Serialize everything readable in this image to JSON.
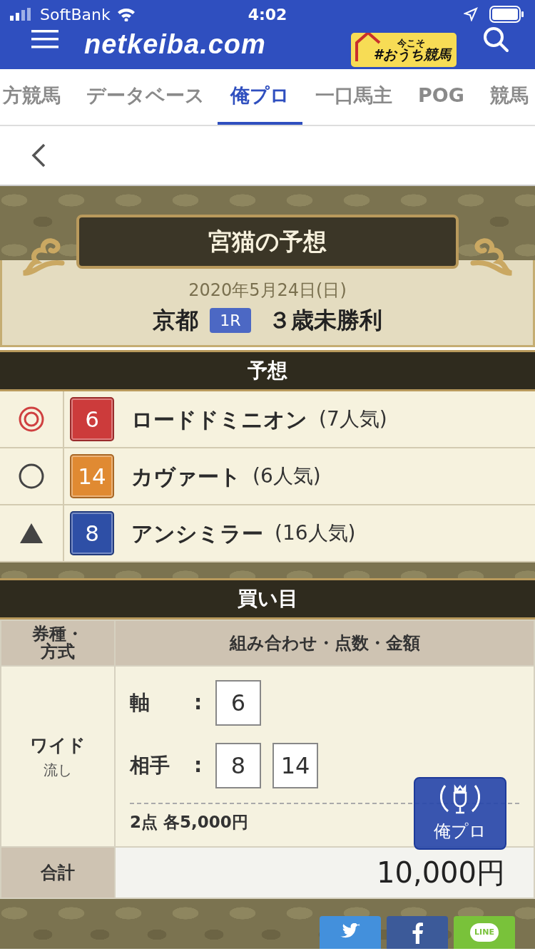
{
  "status_bar": {
    "carrier": "SoftBank",
    "time": "4:02"
  },
  "header": {
    "logo": "netkeiba.com",
    "banner_top": "今こそ",
    "banner_main": "#おうち競馬"
  },
  "tabs": [
    {
      "label": "方競馬",
      "selected": false
    },
    {
      "label": "データベース",
      "selected": false
    },
    {
      "label": "俺プロ",
      "selected": true
    },
    {
      "label": "一口馬主",
      "selected": false
    },
    {
      "label": "POG",
      "selected": false
    },
    {
      "label": "競馬",
      "selected": false
    }
  ],
  "prediction": {
    "title": "宮猫の予想",
    "date": "2020年5月24日(日)",
    "venue": "京都",
    "race_number": "1R",
    "race_name": "３歳未勝利"
  },
  "picks_heading": "予想",
  "picks": [
    {
      "kind": "double-circle",
      "number": "6",
      "color": "#cc3b3b",
      "horse": "ロードドミニオン",
      "popularity": "(7人気)"
    },
    {
      "kind": "circle",
      "number": "14",
      "color": "#e08a32",
      "horse": "カヴァート",
      "popularity": "(6人気)"
    },
    {
      "kind": "triangle",
      "number": "8",
      "color": "#2e4fa6",
      "horse": "アンシミラー",
      "popularity": "(16人気)"
    }
  ],
  "bets_heading": "買い目",
  "bet_table": {
    "columns": [
      "券種・方式",
      "組み合わせ・点数・金額"
    ],
    "bet_type": "ワイド",
    "bet_method": "流し",
    "axis_label": "軸",
    "axis": [
      "6"
    ],
    "partner_label": "相手",
    "partners": [
      "8",
      "14"
    ],
    "separator": ":",
    "summary": "2点 各5,000円",
    "total_label": "合計",
    "total": "10,000円"
  },
  "float_button": {
    "label": "俺プロ"
  },
  "share": [
    {
      "kind": "twitter"
    },
    {
      "kind": "facebook"
    },
    {
      "kind": "line",
      "label": "LINE"
    }
  ]
}
